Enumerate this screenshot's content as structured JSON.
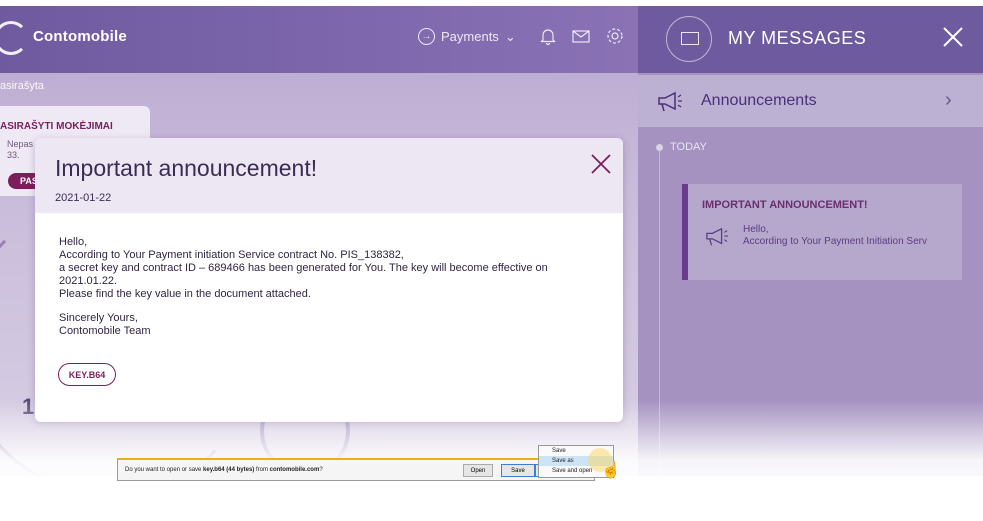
{
  "app": {
    "brand": "Contomobile",
    "nav_payments": "Payments",
    "breadcrumb": "asirašyta",
    "card": {
      "title": "ASIRAŠYTI MOKĖJIMAI",
      "line1": "Nepas",
      "line2": "33.",
      "pill": "PAS"
    },
    "big_number": "1"
  },
  "messages_panel": {
    "title": "MY MESSAGES",
    "section": "Announcements",
    "group_label": "TODAY",
    "card_title": "IMPORTANT ANNOUNCEMENT!",
    "card_line1": "Hello,",
    "card_line2": "According to Your Payment Initiation Serv"
  },
  "modal": {
    "title": "Important announcement!",
    "date": "2021-01-22",
    "body": {
      "greeting": "Hello,",
      "line1": "According to Your Payment initiation Service contract No. PIS_138382,",
      "line2": "a secret key and contract ID – 689466 has been generated for You. The key will become effective on",
      "line3": "2021.01.22.",
      "line4": "Please find the key value in the document attached.",
      "signoff1": "Sincerely Yours,",
      "signoff2": "Contomobile Team"
    },
    "attachment": "KEY.B64"
  },
  "download_bar": {
    "prompt_prefix": "Do you want to open or save ",
    "file": "key.b64 (44 bytes)",
    "prompt_mid": " from ",
    "site": "contomobile.com",
    "prompt_suffix": "?",
    "open_label": "Open",
    "save_label": "Save",
    "menu": [
      "Save",
      "Save as",
      "Save and open"
    ]
  },
  "colors": {
    "brand_purple": "#6f5aa0",
    "accent_magenta": "#7a1f5a",
    "panel_purple": "#a592c0"
  }
}
